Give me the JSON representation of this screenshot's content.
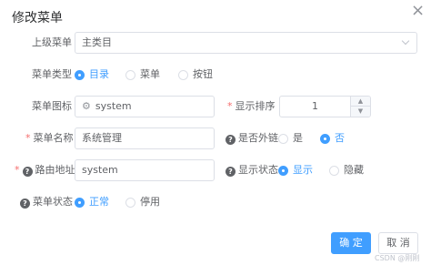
{
  "dialog": {
    "title": "修改菜单",
    "close_glyph": "×"
  },
  "form": {
    "parent": {
      "label": "上级菜单",
      "value": "主类目"
    },
    "type": {
      "label": "菜单类型",
      "options": [
        "目录",
        "菜单",
        "按钮"
      ],
      "selected": "目录"
    },
    "icon": {
      "label": "菜单图标",
      "value": "system",
      "icon": "gear-icon"
    },
    "order": {
      "label": "显示排序",
      "value": "1"
    },
    "name": {
      "label": "菜单名称",
      "value": "系统管理"
    },
    "external": {
      "label": "是否外链",
      "options": [
        "是",
        "否"
      ],
      "selected": "否"
    },
    "path": {
      "label": "路由地址",
      "value": "system"
    },
    "visible": {
      "label": "显示状态",
      "options": [
        "显示",
        "隐藏"
      ],
      "selected": "显示"
    },
    "status": {
      "label": "菜单状态",
      "options": [
        "正常",
        "停用"
      ],
      "selected": "正常"
    },
    "required_mark": "*",
    "help_glyph": "?"
  },
  "footer": {
    "confirm_label": "确 定",
    "cancel_label": "取 消"
  },
  "watermark": "CSDN @刚刚",
  "colors": {
    "primary": "#409eff",
    "required": "#f56c6c",
    "border": "#dcdfe6"
  }
}
